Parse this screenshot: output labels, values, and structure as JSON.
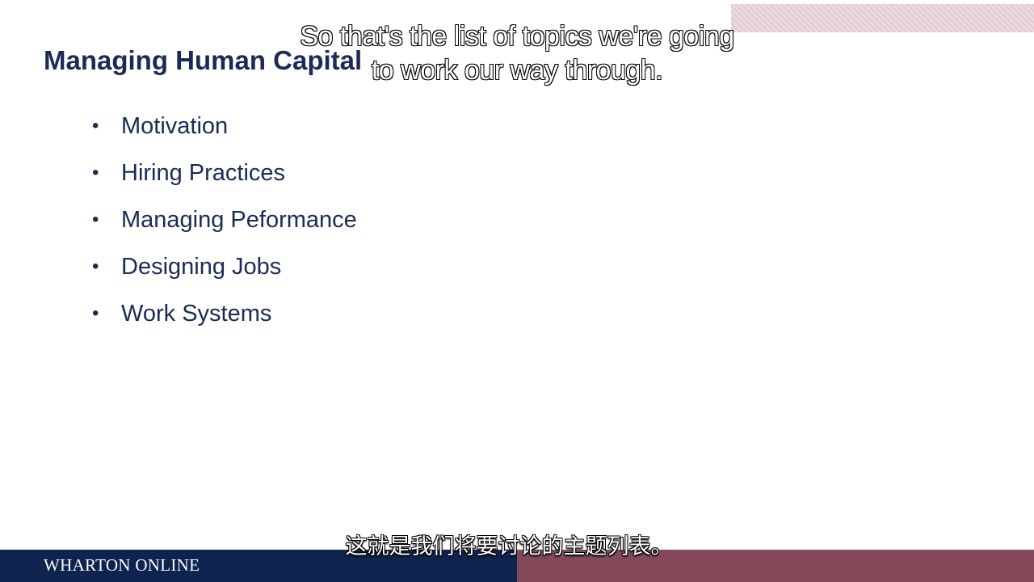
{
  "slide": {
    "title": "Managing Human Capital",
    "bullet_glyph": "•",
    "topics": [
      "Motivation",
      "Hiring Practices",
      "Managing Peformance",
      "Designing Jobs",
      "Work Systems"
    ]
  },
  "captions": {
    "english": "So that's the list of topics we're going to work our way through.",
    "chinese": "这就是我们将要讨论的主题列表。"
  },
  "footer": {
    "brand": "WHARTON ONLINE"
  },
  "colors": {
    "title_navy": "#1b2a57",
    "footer_navy": "#0f2350",
    "footer_maroon": "#854a5a",
    "accent_pink": "#e2cdd3"
  }
}
